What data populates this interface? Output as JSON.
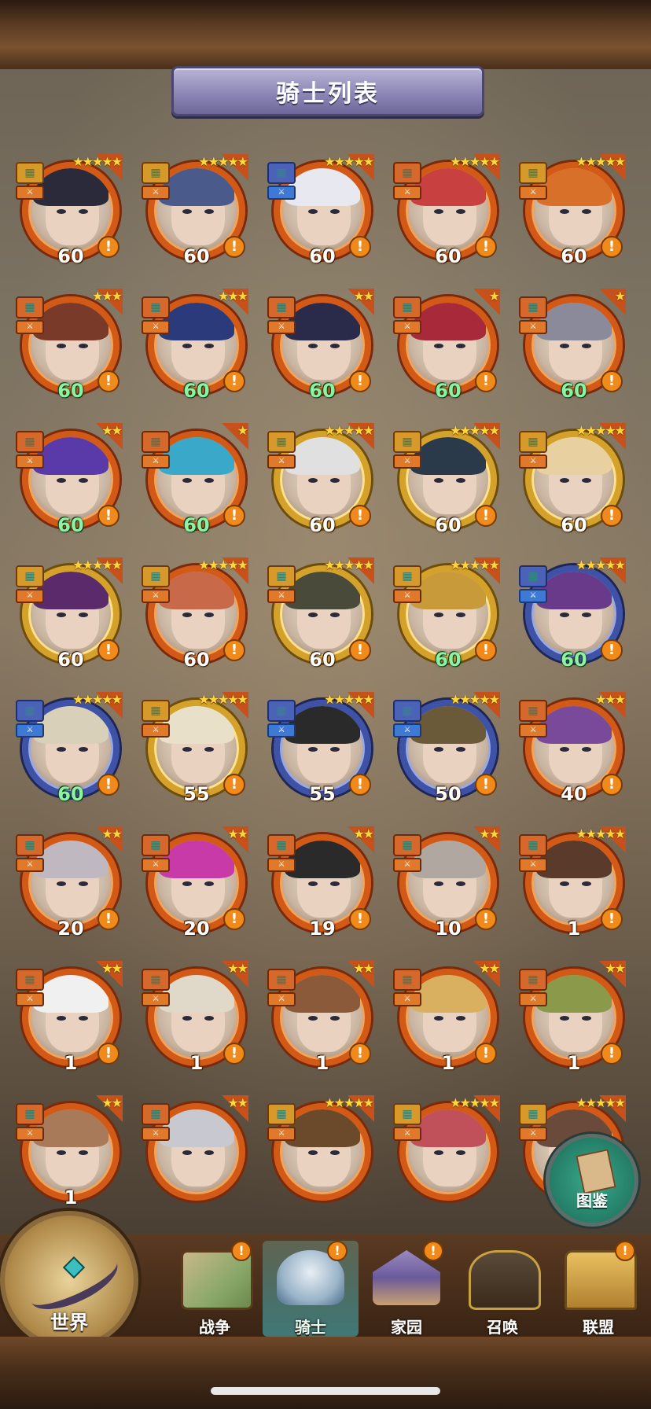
{
  "header": {
    "title": "骑士列表"
  },
  "icons": {
    "alert": "!",
    "star": "★"
  },
  "knights": [
    {
      "level": "60",
      "stars": 5,
      "frame": "orange",
      "level_color": "white",
      "type": "gold"
    },
    {
      "level": "60",
      "stars": 5,
      "frame": "orange",
      "level_color": "white",
      "type": "gold"
    },
    {
      "level": "60",
      "stars": 5,
      "frame": "orange",
      "level_color": "white",
      "type": "blue"
    },
    {
      "level": "60",
      "stars": 5,
      "frame": "orange",
      "level_color": "white",
      "type": "orange"
    },
    {
      "level": "60",
      "stars": 5,
      "frame": "orange",
      "level_color": "white",
      "type": "gold"
    },
    {
      "level": "60",
      "stars": 3,
      "frame": "orange",
      "level_color": "green",
      "type": "orange"
    },
    {
      "level": "60",
      "stars": 3,
      "frame": "orange",
      "level_color": "green",
      "type": "orange"
    },
    {
      "level": "60",
      "stars": 2,
      "frame": "orange",
      "level_color": "green",
      "type": "orange"
    },
    {
      "level": "60",
      "stars": 1,
      "frame": "orange",
      "level_color": "green",
      "type": "orange"
    },
    {
      "level": "60",
      "stars": 1,
      "frame": "orange",
      "level_color": "green",
      "type": "orange"
    },
    {
      "level": "60",
      "stars": 2,
      "frame": "orange",
      "level_color": "green",
      "type": "orange"
    },
    {
      "level": "60",
      "stars": 1,
      "frame": "orange",
      "level_color": "green",
      "type": "orange"
    },
    {
      "level": "60",
      "stars": 5,
      "frame": "gold",
      "level_color": "white",
      "type": "gold"
    },
    {
      "level": "60",
      "stars": 5,
      "frame": "gold",
      "level_color": "white",
      "type": "gold"
    },
    {
      "level": "60",
      "stars": 5,
      "frame": "gold",
      "level_color": "white",
      "type": "gold"
    },
    {
      "level": "60",
      "stars": 5,
      "frame": "gold",
      "level_color": "white",
      "type": "gold"
    },
    {
      "level": "60",
      "stars": 5,
      "frame": "orange",
      "level_color": "white",
      "type": "gold"
    },
    {
      "level": "60",
      "stars": 5,
      "frame": "gold",
      "level_color": "white",
      "type": "gold"
    },
    {
      "level": "60",
      "stars": 5,
      "frame": "gold",
      "level_color": "green",
      "type": "gold"
    },
    {
      "level": "60",
      "stars": 5,
      "frame": "blue",
      "level_color": "green",
      "type": "blue"
    },
    {
      "level": "60",
      "stars": 5,
      "frame": "blue",
      "level_color": "green",
      "type": "blue"
    },
    {
      "level": "55",
      "stars": 5,
      "frame": "gold",
      "level_color": "white",
      "type": "gold"
    },
    {
      "level": "55",
      "stars": 5,
      "frame": "blue",
      "level_color": "white",
      "type": "blue"
    },
    {
      "level": "50",
      "stars": 5,
      "frame": "blue",
      "level_color": "white",
      "type": "blue"
    },
    {
      "level": "40",
      "stars": 3,
      "frame": "orange",
      "level_color": "white",
      "type": "orange"
    },
    {
      "level": "20",
      "stars": 2,
      "frame": "orange",
      "level_color": "white",
      "type": "orange"
    },
    {
      "level": "20",
      "stars": 2,
      "frame": "orange",
      "level_color": "white",
      "type": "orange"
    },
    {
      "level": "19",
      "stars": 2,
      "frame": "orange",
      "level_color": "white",
      "type": "orange"
    },
    {
      "level": "10",
      "stars": 2,
      "frame": "orange",
      "level_color": "white",
      "type": "orange"
    },
    {
      "level": "1",
      "stars": 5,
      "frame": "orange",
      "level_color": "white",
      "type": "orange"
    },
    {
      "level": "1",
      "stars": 2,
      "frame": "orange",
      "level_color": "white",
      "type": "orange"
    },
    {
      "level": "1",
      "stars": 2,
      "frame": "orange",
      "level_color": "white",
      "type": "orange"
    },
    {
      "level": "1",
      "stars": 2,
      "frame": "orange",
      "level_color": "white",
      "type": "orange"
    },
    {
      "level": "1",
      "stars": 2,
      "frame": "orange",
      "level_color": "white",
      "type": "orange"
    },
    {
      "level": "1",
      "stars": 2,
      "frame": "orange",
      "level_color": "white",
      "type": "orange"
    },
    {
      "level": "1",
      "stars": 2,
      "frame": "orange",
      "level_color": "white",
      "type": "orange"
    },
    {
      "level": "",
      "stars": 2,
      "frame": "orange",
      "level_color": "white",
      "type": "orange"
    },
    {
      "level": "",
      "stars": 5,
      "frame": "orange",
      "level_color": "white",
      "type": "gold"
    },
    {
      "level": "",
      "stars": 5,
      "frame": "orange",
      "level_color": "white",
      "type": "gold"
    },
    {
      "level": "",
      "stars": 5,
      "frame": "orange",
      "level_color": "white",
      "type": "gold"
    }
  ],
  "codex": {
    "label": "图鉴"
  },
  "nav": {
    "world": "世界",
    "tabs": [
      {
        "label": "战争",
        "alert": true
      },
      {
        "label": "骑士",
        "alert": true,
        "active": true
      },
      {
        "label": "家园",
        "alert": true
      },
      {
        "label": "召唤",
        "alert": false
      },
      {
        "label": "联盟",
        "alert": true
      }
    ]
  }
}
